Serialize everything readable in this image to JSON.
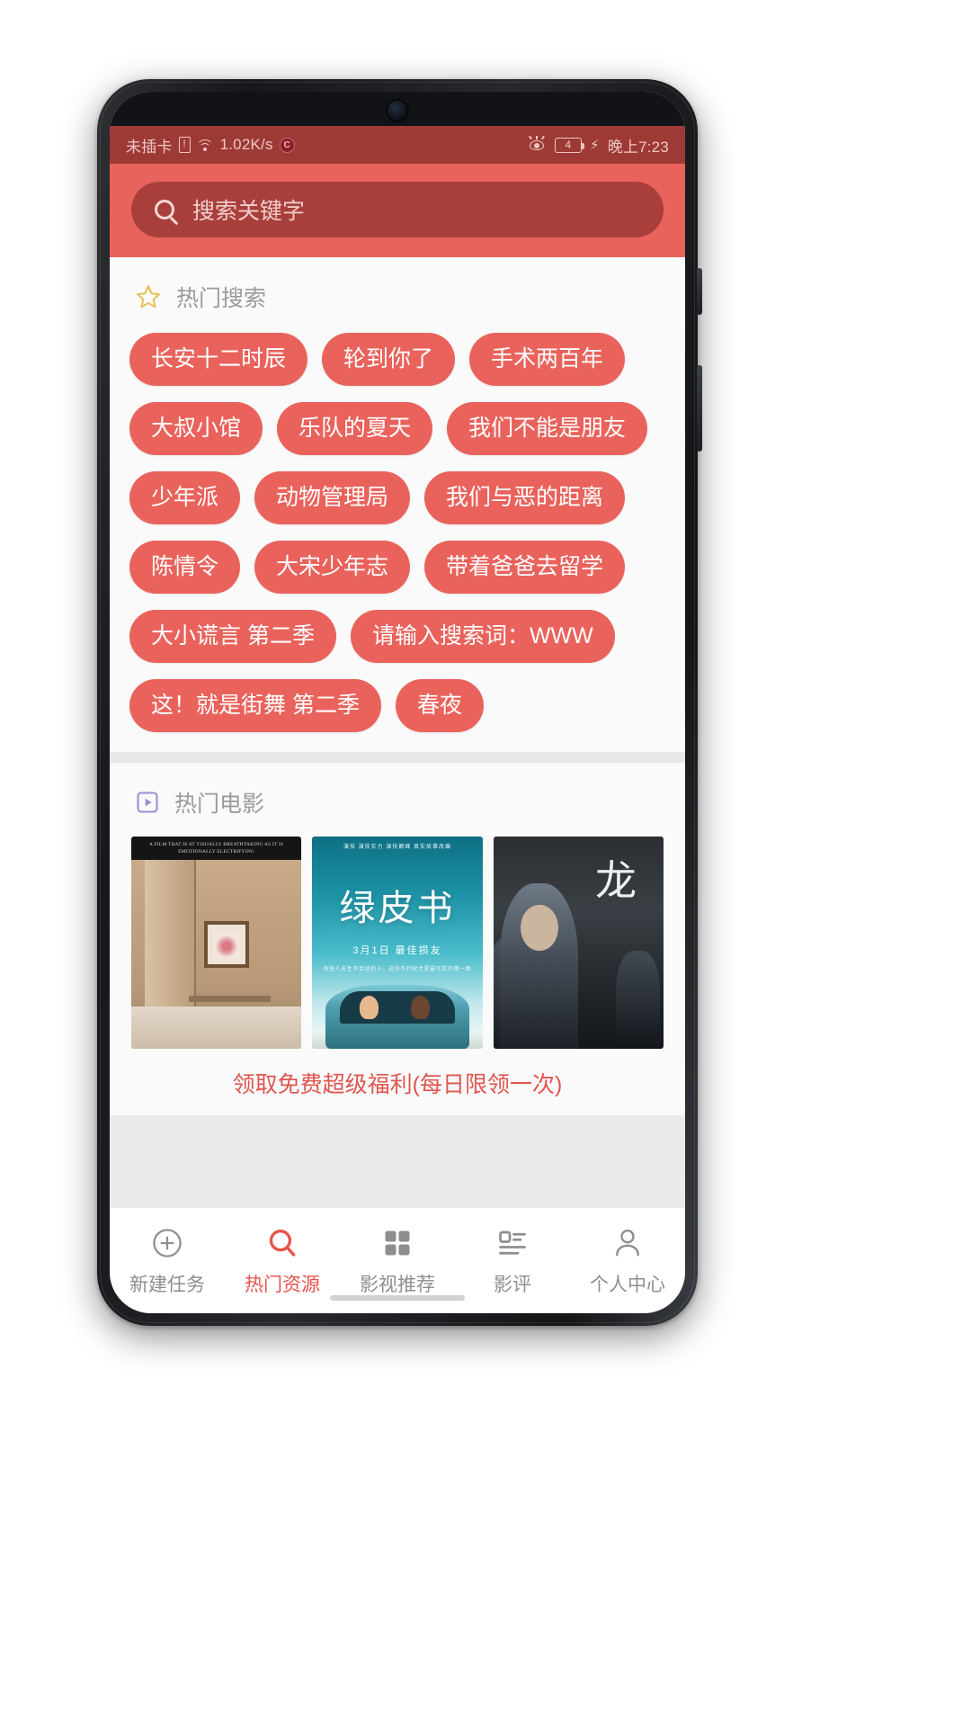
{
  "status_bar": {
    "carrier": "未插卡",
    "sim_icon": "sim-warning-icon",
    "wifi_icon": "wifi-icon",
    "network_speed": "1.02K/s",
    "app_badge": "C",
    "eye_comfort_icon": "eye-comfort-icon",
    "battery_level": "4",
    "charging_icon": "lightning-bolt-icon",
    "time": "晚上7:23"
  },
  "search": {
    "icon": "search-icon",
    "placeholder": "搜索关键字",
    "value": ""
  },
  "hot_search": {
    "icon": "star-icon",
    "title": "热门搜索",
    "tags": [
      "长安十二时辰",
      "轮到你了",
      "手术两百年",
      "大叔小馆",
      "乐队的夏天",
      "我们不能是朋友",
      "少年派",
      "动物管理局",
      "我们与恶的距离",
      "陈情令",
      "大宋少年志",
      "带着爸爸去留学",
      "大小谎言 第二季",
      "请输入搜索词：WWW",
      "这！就是街舞 第二季",
      "春夜"
    ]
  },
  "hot_movies": {
    "icon": "play-square-icon",
    "title": "热门电影",
    "posters": [
      {
        "name": "poster-room-interior",
        "caption": "A FILM THAT IS AT VISUALLY BREATHTAKING AS IT IS EMOTIONALLY ELECTRIFYING"
      },
      {
        "name": "poster-green-book",
        "top_line": "演技 演技实力 演技巅峰 真实故事改编",
        "title": "绿皮书",
        "subtitle": "3月1日  最佳损友",
        "tagline": "有些人天生不合适的人，这份不打扰才是最写实的第一面"
      },
      {
        "name": "poster-dark-action",
        "title": "龙"
      }
    ]
  },
  "promo": {
    "text": "领取免费超级福利(每日限领一次)"
  },
  "tabbar": {
    "items": [
      {
        "icon": "plus-circle-icon",
        "label": "新建任务",
        "active": false
      },
      {
        "icon": "search-icon",
        "label": "热门资源",
        "active": true
      },
      {
        "icon": "grid-squares-icon",
        "label": "影视推荐",
        "active": false
      },
      {
        "icon": "list-icon",
        "label": "影评",
        "active": false
      },
      {
        "icon": "user-icon",
        "label": "个人中心",
        "active": false
      }
    ]
  },
  "colors": {
    "brand_red": "#e8635c",
    "status_red": "#9e3a36",
    "search_pill": "#a93f3b",
    "tag_red": "#e9635c",
    "promo_red": "#e0564f",
    "star_gold": "#e8c15a",
    "play_purple": "#9b8fd6"
  }
}
